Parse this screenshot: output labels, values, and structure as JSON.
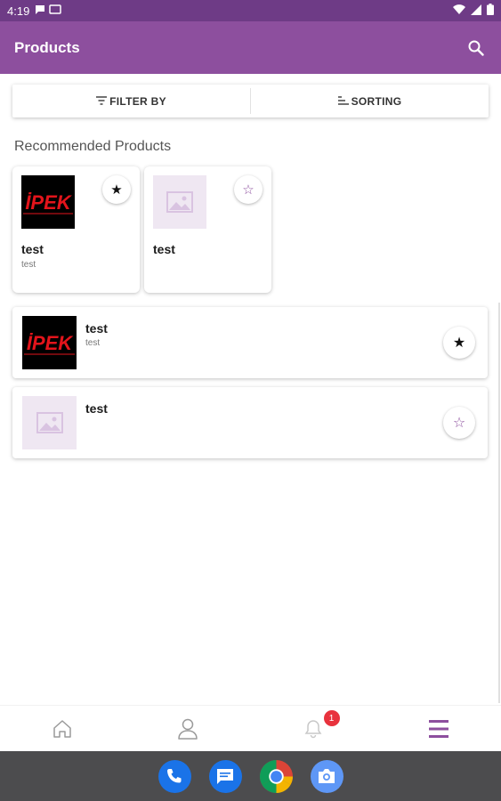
{
  "status_bar": {
    "time": "4:19"
  },
  "app_bar": {
    "title": "Products"
  },
  "filters": {
    "filter_label": "FILTER BY",
    "sort_label": "SORTING"
  },
  "section": {
    "title": "Recommended Products"
  },
  "recommended": [
    {
      "name": "test",
      "subtitle": "test",
      "image": "ipek-logo",
      "logo_text": "İPEK",
      "favorite": true
    },
    {
      "name": "test",
      "subtitle": "",
      "image": "placeholder-image",
      "favorite": false
    }
  ],
  "products": [
    {
      "name": "test",
      "subtitle": "test",
      "image": "ipek-logo",
      "logo_text": "İPEK",
      "favorite": true
    },
    {
      "name": "test",
      "subtitle": "",
      "image": "placeholder-image",
      "favorite": false
    }
  ],
  "bottom_nav": {
    "items": [
      "home-icon",
      "profile-icon",
      "notifications-icon",
      "menu-icon"
    ],
    "notification_badge": "1",
    "active": "menu-icon"
  },
  "dock": {
    "apps": [
      "phone-icon",
      "messages-icon",
      "chrome-icon",
      "camera-icon"
    ]
  },
  "colors": {
    "primary": "#8d4f9e",
    "status_bar": "#6e3b86",
    "badge": "#e8323d",
    "logo_red": "#e3141b"
  }
}
